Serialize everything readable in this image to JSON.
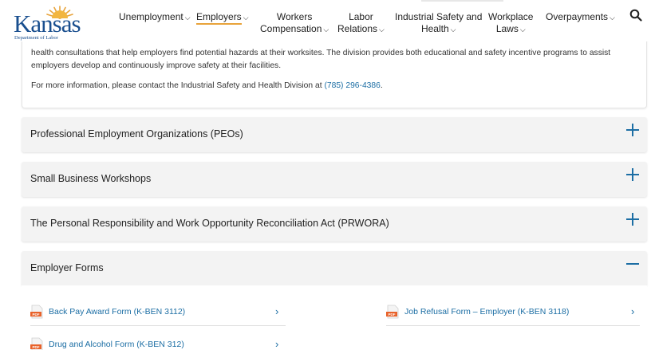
{
  "header": {
    "logo": {
      "word": "Kansas",
      "sub": "Department of Labor"
    },
    "nav": [
      {
        "label": "Unemployment",
        "line2": "",
        "chevron": "⌵",
        "active": false
      },
      {
        "label": "Employers",
        "line2": "",
        "chevron": "⌵",
        "active": true
      },
      {
        "label": "Workers",
        "line2": "Compensation",
        "chevron": "⌵",
        "active": false
      },
      {
        "label": "Labor",
        "line2": "Relations",
        "chevron": "⌵",
        "active": false
      },
      {
        "label": "Industrial Safety and",
        "line2": "Health",
        "chevron": "⌵",
        "active": false
      },
      {
        "label": "Workplace",
        "line2": "Laws",
        "chevron": "⌵",
        "active": false
      },
      {
        "label": "Overpayments",
        "line2": "",
        "chevron": "⌵",
        "active": false
      }
    ],
    "search_icon": "search-icon"
  },
  "intro": {
    "p1": "health consultations that help employers find potential hazards at their worksites. The division provides both educational and safety incentive programs to assist employers develop and continuously improve safety at their facilities.",
    "p2_prefix": "For more information, please contact the Industrial Safety and Health Division at ",
    "p2_phone": "(785) 296-4386",
    "p2_suffix": "."
  },
  "accordions": [
    {
      "title": "Professional Employment Organizations (PEOs)",
      "state": "collapsed"
    },
    {
      "title": "Small Business Workshops",
      "state": "collapsed"
    },
    {
      "title": "The Personal Responsibility and Work Opportunity Reconciliation Act (PRWORA)",
      "state": "collapsed"
    },
    {
      "title": "Employer Forms",
      "state": "expanded"
    }
  ],
  "forms": [
    {
      "label": "Back Pay Award Form (K-BEN 3112)",
      "icon": "pdf-icon",
      "arrow": "›"
    },
    {
      "label": "Job Refusal Form – Employer (K-BEN 3118)",
      "icon": "pdf-icon",
      "arrow": "›"
    },
    {
      "label": "Drug and Alcohol Form (K-BEN 312)",
      "icon": "pdf-icon",
      "arrow": "›"
    }
  ],
  "colors": {
    "link": "#1c6ea4",
    "brand": "#1a4f8f",
    "accent": "#e8a33a",
    "pdf": "#e8622a"
  }
}
